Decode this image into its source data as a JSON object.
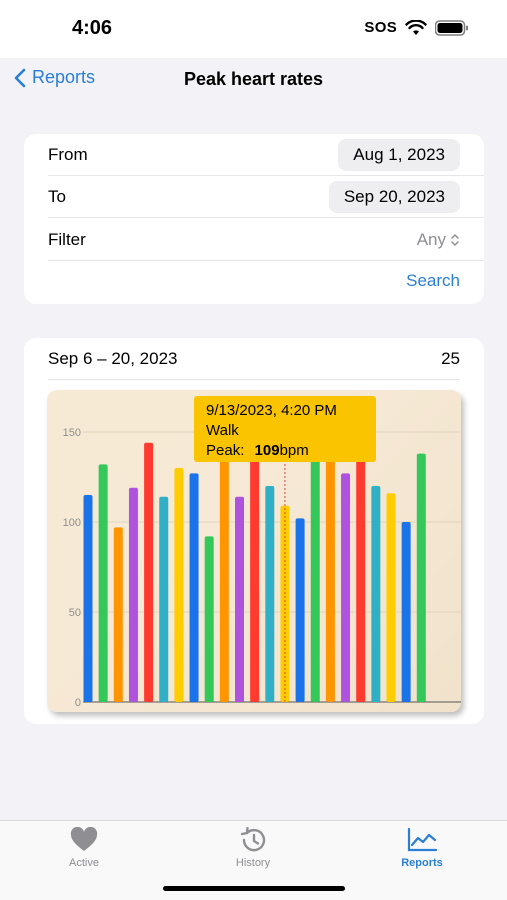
{
  "status": {
    "time": "4:06",
    "sos": "SOS"
  },
  "nav": {
    "back_label": "Reports",
    "title": "Peak heart rates"
  },
  "filters": {
    "from_label": "From",
    "from_value": "Aug 1, 2023",
    "to_label": "To",
    "to_value": "Sep 20, 2023",
    "filter_label": "Filter",
    "filter_value": "Any",
    "search_label": "Search"
  },
  "chart_card": {
    "range": "Sep 6 – 20, 2023",
    "count": "25"
  },
  "tooltip": {
    "datetime": "9/13/2023, 4:20 PM",
    "activity": "Walk",
    "peak_label": "Peak:",
    "peak_value": "109",
    "unit": "bpm"
  },
  "tabs": [
    {
      "label": "Active",
      "icon": "heart-icon"
    },
    {
      "label": "History",
      "icon": "history-icon"
    },
    {
      "label": "Reports",
      "icon": "chart-icon"
    }
  ],
  "colors": {
    "accent": "#2a7fd4",
    "tooltip": "#fbc400"
  },
  "chart_data": {
    "type": "bar",
    "ylim": [
      0,
      160
    ],
    "yticks": [
      "0",
      "50",
      "100",
      "150"
    ],
    "grid": true,
    "selected_index": 13,
    "bars": [
      {
        "value": 115,
        "color": "#1a73e8"
      },
      {
        "value": 132,
        "color": "#34c759"
      },
      {
        "value": 97,
        "color": "#ff9500"
      },
      {
        "value": 119,
        "color": "#af52de"
      },
      {
        "value": 144,
        "color": "#ff3b30"
      },
      {
        "value": 114,
        "color": "#30b0c7"
      },
      {
        "value": 130,
        "color": "#ffcc00"
      },
      {
        "value": 127,
        "color": "#1a73e8"
      },
      {
        "value": 92,
        "color": "#34c759"
      },
      {
        "value": 140,
        "color": "#ff9500"
      },
      {
        "value": 114,
        "color": "#af52de"
      },
      {
        "value": 149,
        "color": "#ff3b30"
      },
      {
        "value": 120,
        "color": "#30b0c7"
      },
      {
        "value": 109,
        "color": "#ffcc00"
      },
      {
        "value": 102,
        "color": "#1a73e8"
      },
      {
        "value": 138,
        "color": "#34c759"
      },
      {
        "value": 150,
        "color": "#ff9500"
      },
      {
        "value": 127,
        "color": "#af52de"
      },
      {
        "value": 134,
        "color": "#ff3b30"
      },
      {
        "value": 120,
        "color": "#30b0c7"
      },
      {
        "value": 116,
        "color": "#ffcc00"
      },
      {
        "value": 100,
        "color": "#1a73e8"
      },
      {
        "value": 138,
        "color": "#34c759"
      }
    ]
  }
}
